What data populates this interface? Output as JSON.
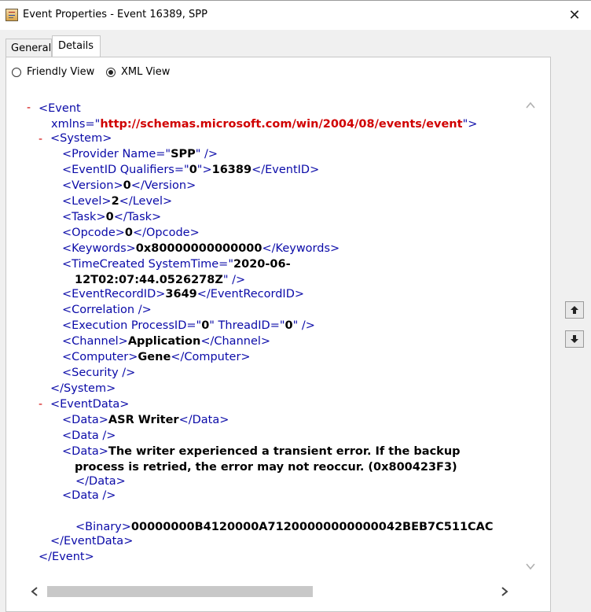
{
  "window": {
    "title": "Event Properties - Event 16389, SPP"
  },
  "tabs": [
    {
      "label": "General"
    },
    {
      "label": "Details"
    }
  ],
  "view_options": {
    "friendly_label": "Friendly View",
    "xml_label": "XML View",
    "selected": "XML View"
  },
  "xml": {
    "event_open": "<Event",
    "xmlns_attr": "xmlns=\"",
    "xmlns_value": "http://schemas.microsoft.com/win/2004/08/events/event",
    "xmlns_close": "\">",
    "system_open": "<System>",
    "provider_pre": "<Provider Name=\"",
    "provider_value": "SPP",
    "provider_post": "\" />",
    "eventid_pre": "<EventID Qualifiers=\"",
    "eventid_qual": "0",
    "eventid_mid": "\">",
    "eventid_value": "16389",
    "eventid_post": "</EventID>",
    "version_pre": "<Version>",
    "version_value": "0",
    "version_post": "</Version>",
    "level_pre": "<Level>",
    "level_value": "2",
    "level_post": "</Level>",
    "task_pre": "<Task>",
    "task_value": "0",
    "task_post": "</Task>",
    "opcode_pre": "<Opcode>",
    "opcode_value": "0",
    "opcode_post": "</Opcode>",
    "keywords_pre": "<Keywords>",
    "keywords_value": "0x80000000000000",
    "keywords_post": "</Keywords>",
    "timecreated_pre": "<TimeCreated SystemTime=\"",
    "timecreated_value_1": "2020-06-",
    "timecreated_value_2": "12T02:07:44.0526278Z",
    "timecreated_post": "\" />",
    "recordid_pre": "<EventRecordID>",
    "recordid_value": "3649",
    "recordid_post": "</EventRecordID>",
    "correlation": "<Correlation />",
    "execution_pre": "<Execution ProcessID=\"",
    "execution_pid": "0",
    "execution_mid": "\" ThreadID=\"",
    "execution_tid": "0",
    "execution_post": "\" />",
    "channel_pre": "<Channel>",
    "channel_value": "Application",
    "channel_post": "</Channel>",
    "computer_pre": "<Computer>",
    "computer_value": "Gene",
    "computer_post": "</Computer>",
    "security": "<Security />",
    "system_close": "</System>",
    "eventdata_open": "<EventData>",
    "data1_pre": "<Data>",
    "data1_value": "ASR Writer",
    "data1_post": "</Data>",
    "data_empty": "<Data />",
    "data3_pre": "<Data>",
    "data3_value_1": "The writer experienced a transient error. If the backup",
    "data3_value_2": "process is retried, the error may not reoccur. (0x800423F3)",
    "data3_post": "</Data>",
    "binary_pre": "<Binary>",
    "binary_value": "00000000B4120000A71200000000000042BEB7C511CAC",
    "eventdata_close": "</EventData>",
    "event_close": "</Event>",
    "minus": "-"
  },
  "icons": {
    "close": "close-icon",
    "up": "arrow-up-icon",
    "down": "arrow-down-icon"
  }
}
